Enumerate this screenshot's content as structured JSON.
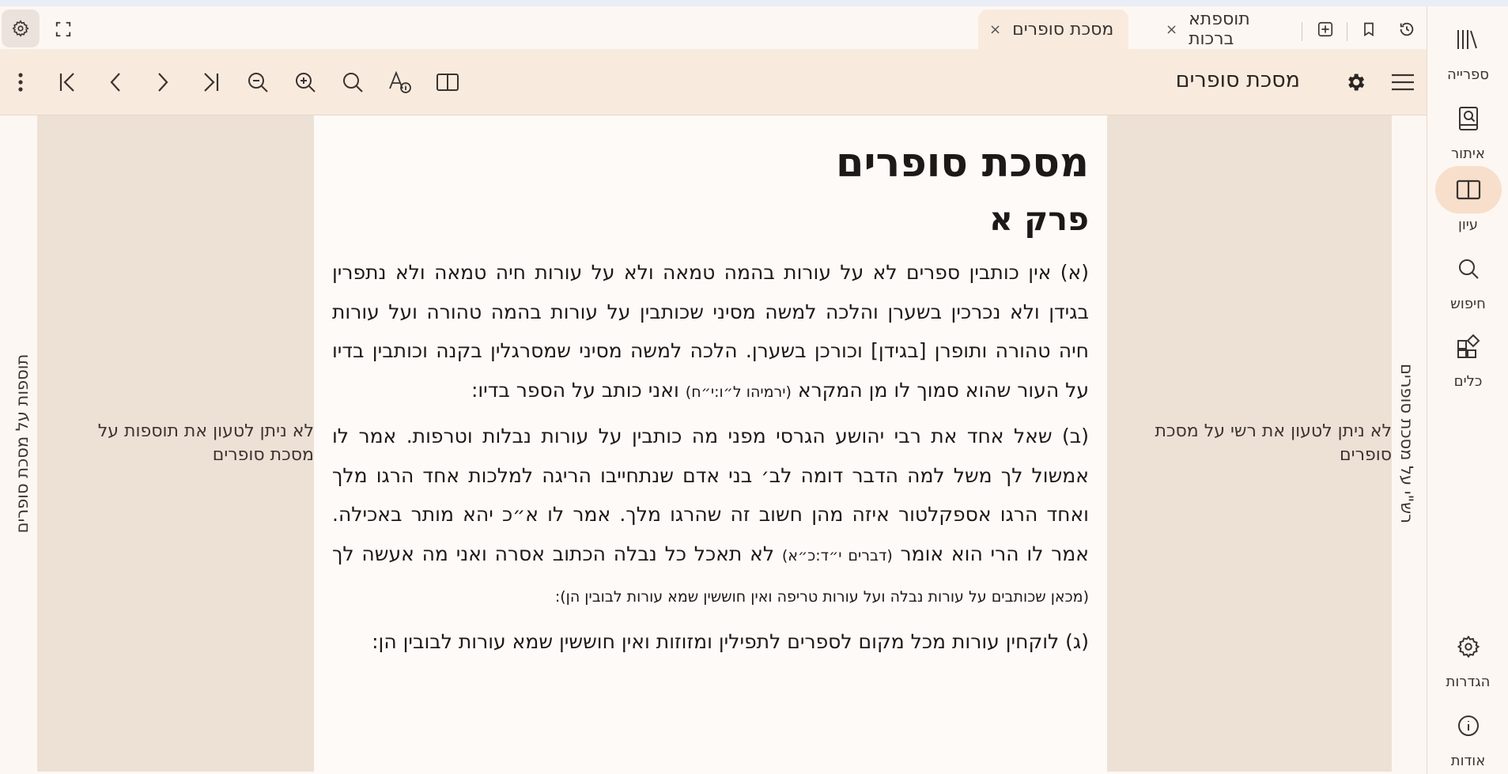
{
  "tabs": [
    {
      "label": "מסכת סופרים",
      "active": true
    },
    {
      "label": "תוספתא ברכות",
      "active": false
    }
  ],
  "toolbar": {
    "book_title": "מסכת סופרים"
  },
  "rail": {
    "library": "ספרייה",
    "find": "איתור",
    "study": "עיון",
    "search": "חיפוש",
    "tools": "כלים",
    "settings": "הגדרות",
    "about": "אודות"
  },
  "panes": {
    "right_label": "רש\"י על מסכת סופרים",
    "right_message": "לא ניתן לטעון את רשי על מסכת סופרים",
    "left_label": "תוספות על מסכת סופרים",
    "left_message": "לא ניתן לטעון את תוספות על מסכת סופרים"
  },
  "text": {
    "title": "מסכת סופרים",
    "chapter": "פרק א",
    "p1_a": "(א) אין כותבין ספרים לא על עורות בהמה טמאה ולא על עורות חיה טמאה ולא נתפרין בגידן ולא נכרכין בשערן והלכה למשה מסיני שכותבין על עורות בהמה טהורה ועל עורות חיה טהורה ותופרן [בגידן] וכורכן בשערן. הלכה למשה מסיני שמסרגלין בקנה וכותבין בדיו על העור שהוא סמוך לו מן המקרא",
    "p1_ref": "(ירמיהו ל״ו:י״ח)",
    "p1_b": "ואני כותב על הספר בדיו:",
    "p2_a": "(ב) שאל אחד את רבי יהושע הגרסי מפני מה כותבין על עורות נבלות וטרפות. אמר לו אמשול לך משל למה הדבר דומה לב׳ בני אדם שנתחייבו הריגה למלכות אחד הרגו מלך ואחד הרגו אספקלטור איזה מהן חשוב זה שהרגו מלך. אמר לו א״כ יהא מותר באכילה. אמר לו הרי הוא אומר",
    "p2_ref": "(דברים י״ד:כ״א)",
    "p2_b": "לא תאכל כל נבלה הכתוב אסרה ואני מה אעשה לך",
    "p2_note": "(מכאן שכותבים על עורות נבלה ועל עורות טריפה ואין חוששין שמא עורות לבובין הן):",
    "p3": "(ג) לוקחין עורות מכל מקום לספרים לתפילין ומזוזות ואין חוששין שמא עורות לבובין הן:"
  }
}
